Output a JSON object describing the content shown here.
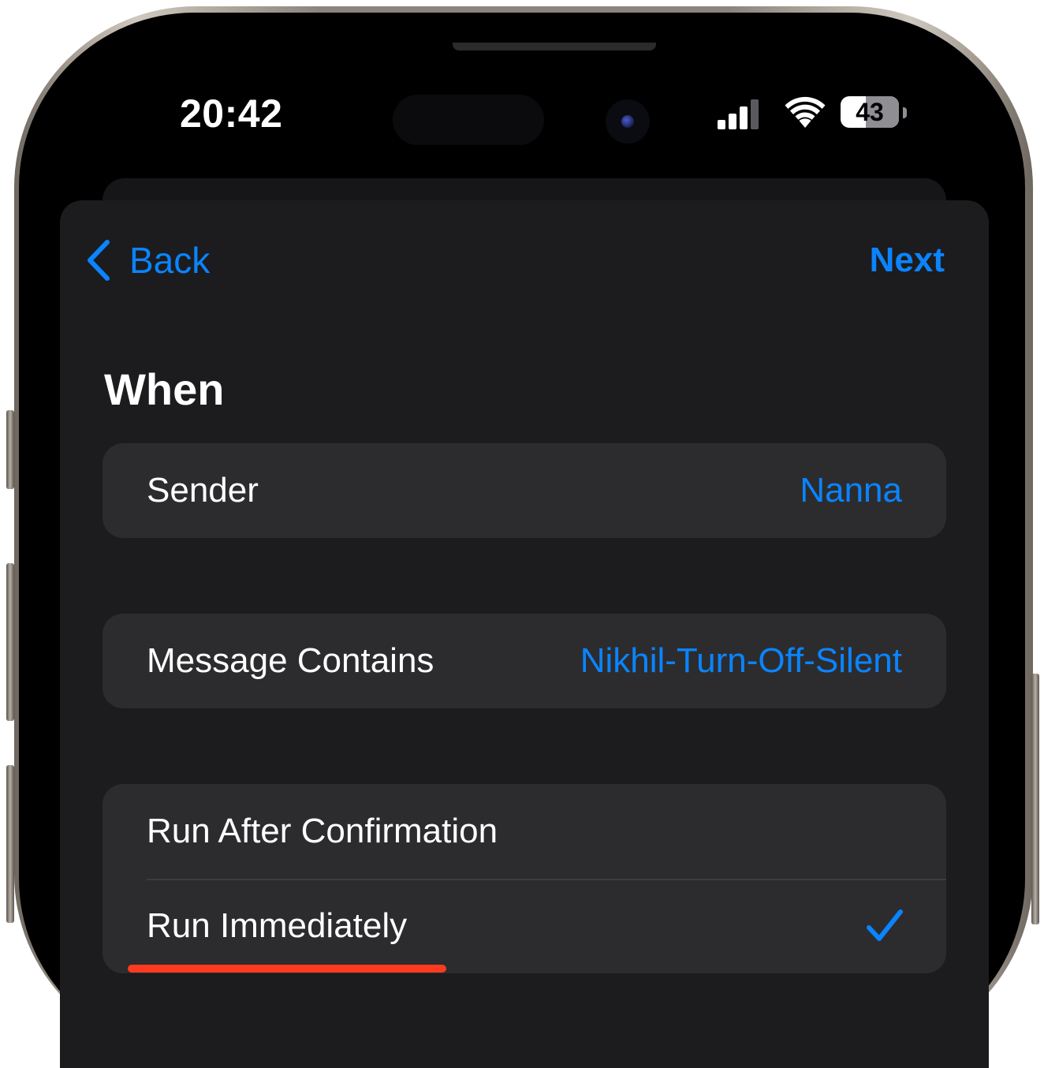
{
  "status_bar": {
    "time": "20:42",
    "battery_percent": "43",
    "battery_level": 0.43
  },
  "nav": {
    "back_label": "Back",
    "next_label": "Next"
  },
  "section": {
    "title": "When"
  },
  "sender_row": {
    "label": "Sender",
    "value": "Nanna"
  },
  "message_row": {
    "label": "Message Contains",
    "value": "Nikhil-Turn-Off-Silent"
  },
  "run_options": {
    "items": [
      {
        "label": "Run After Confirmation",
        "selected": false
      },
      {
        "label": "Run Immediately",
        "selected": true
      }
    ]
  },
  "colors": {
    "accent": "#0a84ff",
    "highlight": "#ff3b1f",
    "sheet_background": "#1c1c1e",
    "row_background": "#2c2c2e"
  }
}
